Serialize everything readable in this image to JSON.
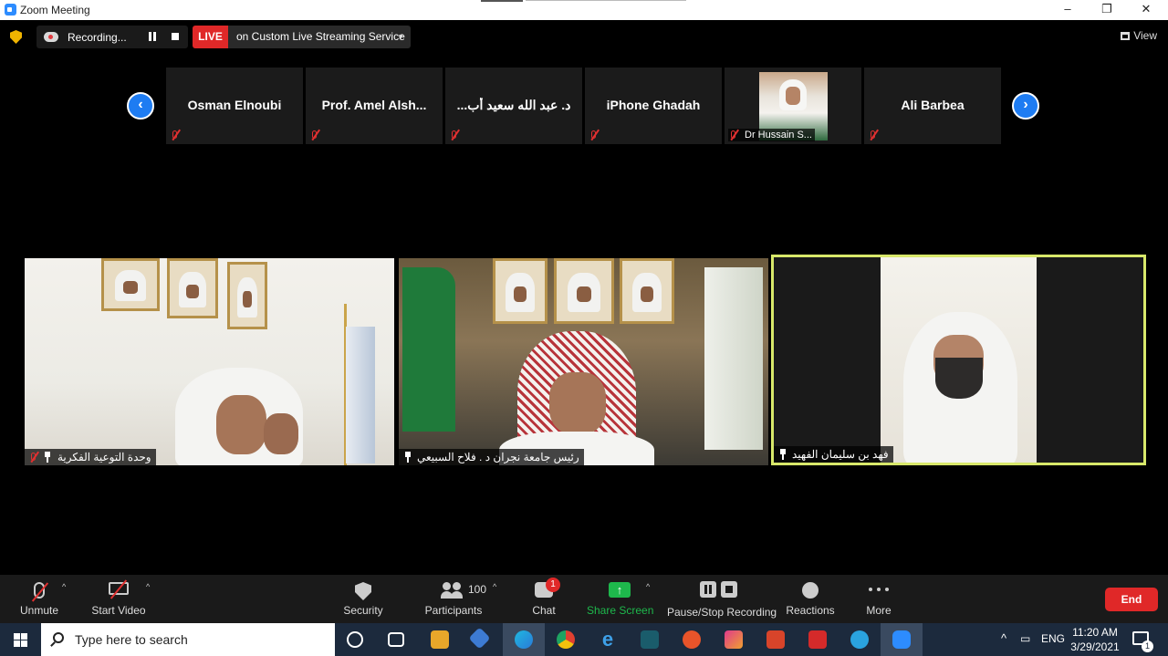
{
  "window": {
    "title": "Zoom Meeting",
    "minimize": "–",
    "restore": "❐",
    "close": "✕"
  },
  "topbar": {
    "recording_text": "Recording...",
    "live_badge": "LIVE",
    "live_service": "on Custom Live Streaming Service",
    "view_label": "View"
  },
  "gallery_strip": {
    "participants": [
      {
        "name": "Osman Elnoubi",
        "muted": true
      },
      {
        "name": "Prof. Amel Alsh...",
        "muted": true
      },
      {
        "name": "د. عبد الله سعيد أب...",
        "muted": true
      },
      {
        "name": "iPhone Ghadah",
        "muted": true
      },
      {
        "name": "Dr Hussain S...",
        "muted": true,
        "has_video": true
      },
      {
        "name": "Ali Barbea",
        "muted": true
      }
    ]
  },
  "main_tiles": [
    {
      "name": "وحدة التوعية الفكرية",
      "muted": true,
      "pinned": true
    },
    {
      "name": "رئيس جامعة نجران د . فلاح السبيعي",
      "muted": false,
      "pinned": true
    },
    {
      "name": "فهد بن سليمان الفهيد",
      "muted": false,
      "pinned": true,
      "active_speaker": true,
      "highlight_color": "#d8e86a"
    }
  ],
  "controls": {
    "unmute": "Unmute",
    "start_video": "Start Video",
    "security": "Security",
    "participants": "Participants",
    "participants_count": "100",
    "chat": "Chat",
    "chat_badge": "1",
    "share_screen": "Share Screen",
    "pause_stop_recording": "Pause/Stop Recording",
    "reactions": "Reactions",
    "more": "More",
    "end": "End",
    "share_color": "#1eb84c",
    "end_color": "#e02828"
  },
  "taskbar": {
    "search_placeholder": "Type here to search",
    "language": "ENG",
    "time": "11:20 AM",
    "date": "3/29/2021",
    "notification_count": "1",
    "apps": [
      "task-view-icon",
      "file-explorer-icon",
      "virtualbox-icon",
      "edge-icon",
      "chrome-icon",
      "internet-explorer-icon",
      "app-icon",
      "app-r-icon",
      "app-cube-icon",
      "office-icon",
      "app-red-icon",
      "telegram-icon",
      "zoom-icon"
    ]
  }
}
